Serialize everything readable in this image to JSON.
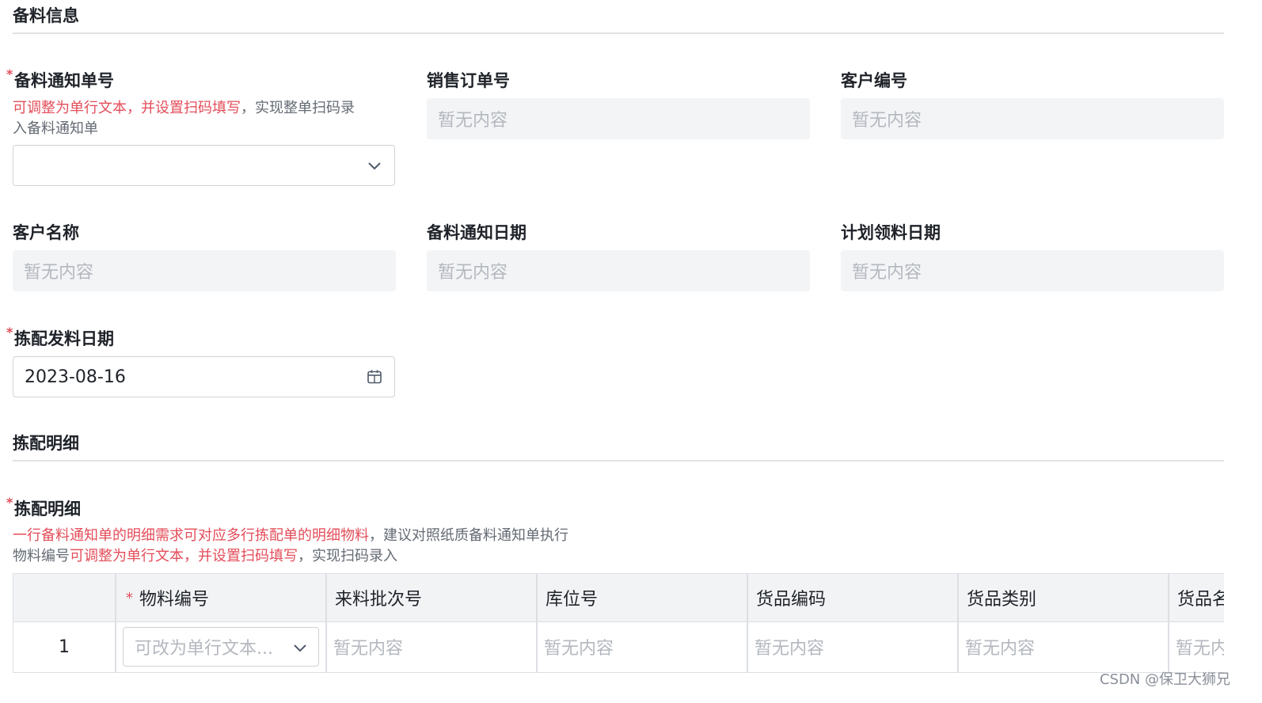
{
  "sections": {
    "prep_info": "备料信息",
    "pick_detail": "拣配明细"
  },
  "fields": {
    "notice_no": {
      "label": "备料通知单号",
      "hint_red": "可调整为单行文本，并设置扫码填写",
      "hint_gray_1": "，实现整单扫码录",
      "hint_gray_2": "入备料通知单",
      "value": ""
    },
    "sales_order": {
      "label": "销售订单号",
      "placeholder": "暂无内容"
    },
    "customer_code": {
      "label": "客户编号",
      "placeholder": "暂无内容"
    },
    "customer_name": {
      "label": "客户名称",
      "placeholder": "暂无内容"
    },
    "notice_date": {
      "label": "备料通知日期",
      "placeholder": "暂无内容"
    },
    "plan_date": {
      "label": "计划领料日期",
      "placeholder": "暂无内容"
    },
    "pick_date": {
      "label": "拣配发料日期",
      "value": "2023-08-16"
    }
  },
  "detail": {
    "label": "拣配明细",
    "hint_line1_red": "一行备料通知单的明细需求可对应多行拣配单的明细物料",
    "hint_line1_gray": "，建议对照纸质备料通知单执行",
    "hint_line2_gray_a": "物料编号",
    "hint_line2_red": "可调整为单行文本，并设置扫码填写",
    "hint_line2_gray_b": "，实现扫码录入"
  },
  "table": {
    "columns": [
      "物料编号",
      "来料批次号",
      "库位号",
      "货品编码",
      "货品类别",
      "货品名"
    ],
    "row": {
      "index": "1",
      "material_placeholder": "可改为单行文本...",
      "empty": "暂无内容"
    }
  },
  "watermark": "CSDN @保卫大狮兄",
  "icons": {
    "dropdown": "chevron-down-icon",
    "calendar": "calendar-icon"
  },
  "colors": {
    "required": "#e34d59",
    "disabled_bg": "#f3f4f6",
    "placeholder": "#b4b8bf"
  }
}
